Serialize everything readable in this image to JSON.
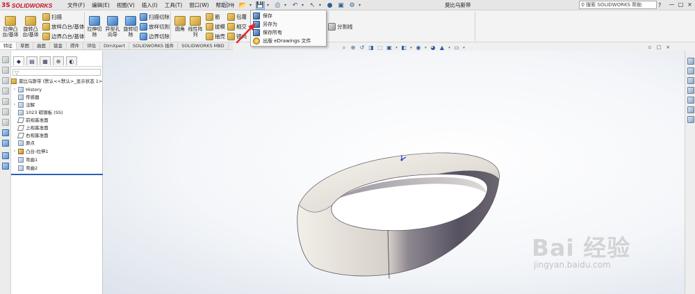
{
  "titlebar": {
    "logo_ds": "3S",
    "logo_text": "SOLIDWORKS",
    "menus": [
      "文件(F)",
      "编辑(E)",
      "视图(V)",
      "插入(I)",
      "工具(T)",
      "窗口(W)",
      "帮助(H)"
    ],
    "doc_title": "莫比乌斯带",
    "help_search_placeholder": "搜索 SOLIDWORKS 帮助",
    "help_question": "?",
    "window_controls": [
      "—",
      "□",
      "×"
    ]
  },
  "command_manager": {
    "extrude_boss": "拉伸凸\n台/基体",
    "revolve_boss": "旋转凸\n台/基体",
    "sweep": "扫描",
    "loft_boss": "放样凸台/基体",
    "boundary_boss": "边界凸台/基体",
    "extrude_cut": "拉伸切\n除",
    "hole_wizard": "异型孔\n向导",
    "revolve_cut": "旋转切\n除",
    "swept_cut": "扫描切除",
    "lofted_cut": "放样切割",
    "boundary_cut": "边界切除",
    "fillet": "圆角",
    "linear_pattern": "线性阵\n列",
    "rib": "筋",
    "draft": "拔模",
    "shell": "抽壳",
    "wrap": "包覆",
    "intersect": "相交",
    "mirror": "镜向",
    "split_line": "分割线"
  },
  "tabs": [
    "特征",
    "草图",
    "曲面",
    "钣金",
    "焊件",
    "评估",
    "DimXpert",
    "SOLIDWORKS 插件",
    "SOLIDWORKS MBD"
  ],
  "save_menu": {
    "items": [
      {
        "label": "保存"
      },
      {
        "label": "另存为"
      },
      {
        "label": "保存所有"
      },
      {
        "label": "出版 eDrawings 文件"
      }
    ]
  },
  "feature_tree": {
    "root": "莫比乌斯带 (默认<<默认>_显示状态 1>)",
    "items": [
      {
        "label": "History"
      },
      {
        "label": "传感器"
      },
      {
        "label": "注解"
      },
      {
        "label": "1023 碳钢板 (SS)"
      },
      {
        "label": "前视基准面"
      },
      {
        "label": "上视基准面"
      },
      {
        "label": "右视基准面"
      },
      {
        "label": "原点"
      },
      {
        "label": "凸台-拉伸1"
      },
      {
        "label": "弯曲1"
      },
      {
        "label": "弯曲2"
      }
    ]
  },
  "watermark": {
    "logo": "Bai  经验",
    "url": "jingyan.baidu.com"
  },
  "colors": {
    "accent": "#2b5fb3",
    "brand_red": "#c8102e",
    "arrow_red": "#e0282a",
    "model_light": "#efece6",
    "model_dark": "#57535a"
  }
}
